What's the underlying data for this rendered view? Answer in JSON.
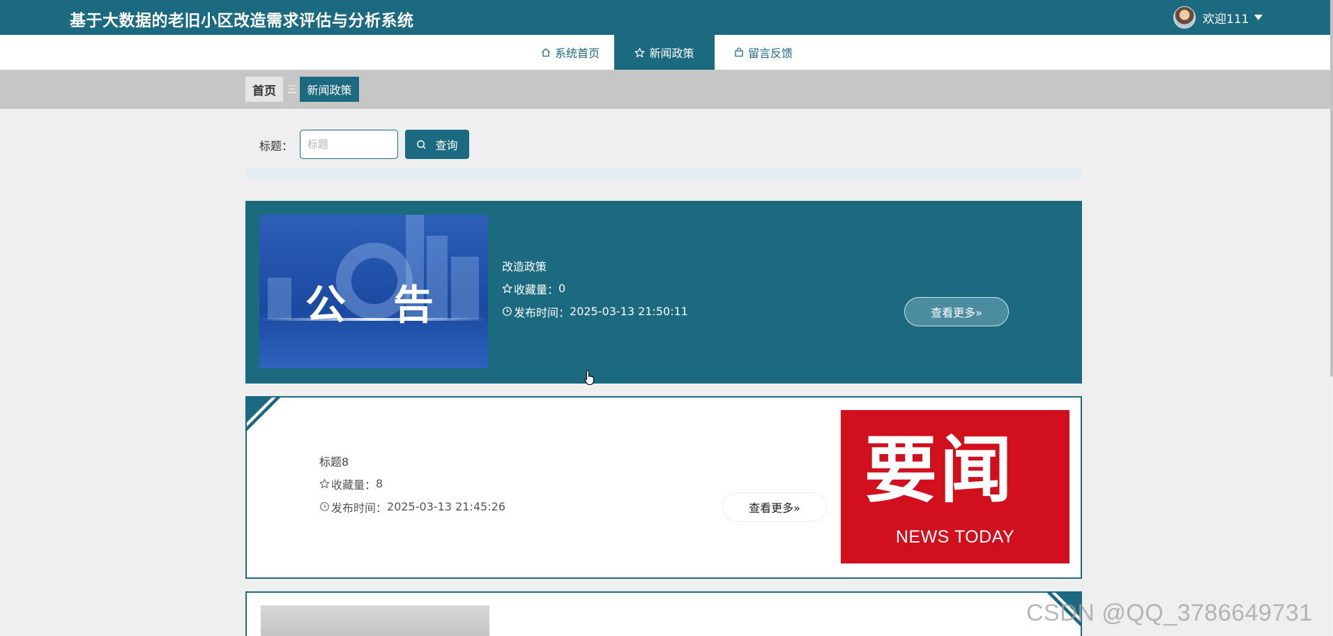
{
  "header": {
    "title": "基于大数据的老旧小区改造需求评估与分析系统",
    "welcome": "欢迎111"
  },
  "nav": {
    "items": [
      {
        "label": "系统首页",
        "icon": "home-icon"
      },
      {
        "label": "新闻政策",
        "icon": "star-icon",
        "active": true
      },
      {
        "label": "留言反馈",
        "icon": "bag-icon"
      }
    ]
  },
  "breadcrumb": {
    "home": "首页",
    "separator": "三",
    "current": "新闻政策"
  },
  "search": {
    "label": "标题：",
    "placeholder": "标题",
    "value": "",
    "button": "查询"
  },
  "news": [
    {
      "title": "改造政策",
      "favorites_label": "收藏量：",
      "favorites": "0",
      "time_label": "发布时间：",
      "time": "2025-03-13 21:50:11",
      "more": "查看更多»",
      "image_text": [
        "公",
        "告"
      ]
    },
    {
      "title": "标题8",
      "favorites_label": "收藏量：",
      "favorites": "8",
      "time_label": "发布时间：",
      "time": "2025-03-13 21:45:26",
      "more": "查看更多»",
      "image_text": [
        "要闻",
        "NEWS TODAY"
      ]
    }
  ],
  "watermark": "CSDN @QQ_3786649731",
  "colors": {
    "primary": "#1b6a80",
    "news_red": "#d10f1d",
    "page_bg": "#efefef",
    "crumb_bg": "#c6c6c6"
  }
}
